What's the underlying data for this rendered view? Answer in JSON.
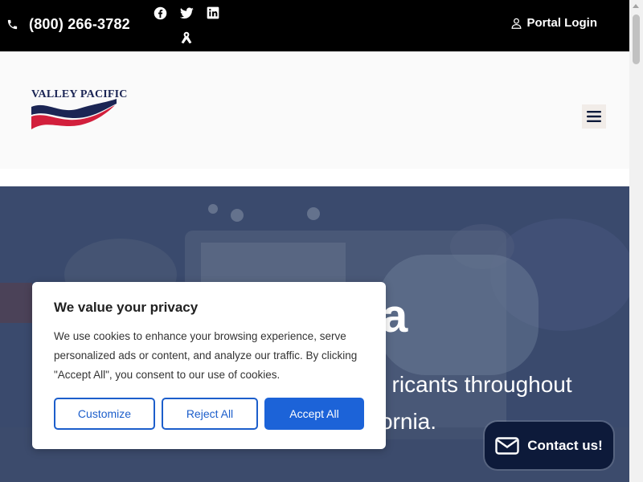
{
  "topbar": {
    "phone": "(800) 266-3782",
    "social_icons": [
      "facebook-icon",
      "twitter-icon",
      "linkedin-icon",
      "ribbon-icon"
    ],
    "portal_login": "Portal Login"
  },
  "header": {
    "logo_text": "VALLEY PACIFIC",
    "menu_icon": "hamburger-icon"
  },
  "hero": {
    "title": "ifornia",
    "text": "pplied high-quality, ricants throughout California."
  },
  "cookie": {
    "title": "We value your privacy",
    "text": "We use cookies to enhance your browsing experience, serve personalized ads or content, and analyze our traffic. By clicking \"Accept All\", you consent to our use of cookies.",
    "customize": "Customize",
    "reject": "Reject All",
    "accept": "Accept All"
  },
  "contact": {
    "label": "Contact us!",
    "icon": "envelope-icon"
  },
  "colors": {
    "topbar": "#000000",
    "primary_blue": "#1c63d8",
    "logo_navy": "#1b2554",
    "logo_red": "#d21f3c",
    "contact_bg": "#0d1a3a"
  }
}
